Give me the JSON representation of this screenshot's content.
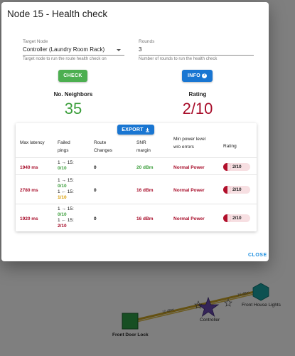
{
  "dialog": {
    "title": "Node 15 - Health check",
    "target_node": {
      "label": "Target Node",
      "value": "Controller (Laundry Room Rack)",
      "help": "Target node to run the route health check on"
    },
    "rounds": {
      "label": "Rounds",
      "value": "3",
      "help": "Number of rounds to run the health check"
    },
    "check_button": "CHECK",
    "info_button": "INFO",
    "neighbors": {
      "label": "No. Neighbors",
      "value": "35"
    },
    "rating": {
      "label": "Rating",
      "value": "2/10"
    },
    "export_button": "EXPORT",
    "table": {
      "headers": {
        "max_latency": "Max latency",
        "failed_pings": "Failed pings",
        "route_changes": "Route Changes",
        "snr_margin": "SNR margin",
        "min_power": "Min power level w/o errors",
        "rating": "Rating"
      },
      "rows": [
        {
          "latency": "1940 ms",
          "pings": [
            {
              "dir": "1 → 15:",
              "val": "0/10"
            }
          ],
          "route_changes": "0",
          "snr": "20 dBm",
          "power": "Normal Power",
          "rating": "2/10"
        },
        {
          "latency": "2780 ms",
          "pings": [
            {
              "dir": "1 → 15:",
              "val": "0/10"
            },
            {
              "dir": "1 ← 15:",
              "val": "1/10"
            }
          ],
          "route_changes": "0",
          "snr": "16 dBm",
          "power": "Normal Power",
          "rating": "2/10"
        },
        {
          "latency": "1920 ms",
          "pings": [
            {
              "dir": "1 → 15:",
              "val": "0/10"
            },
            {
              "dir": "1 ← 15:",
              "val": "2/10"
            }
          ],
          "route_changes": "0",
          "snr": "16 dBm",
          "power": "Normal Power",
          "rating": "2/10"
        }
      ]
    },
    "close_button": "CLOSE"
  },
  "map": {
    "nodes": {
      "front_door_lock": "Front Door Lock",
      "controller": "Controller",
      "front_house_lights": "Front House Lights"
    },
    "edge_labels": [
      "10 dBm",
      "10 dBm"
    ]
  },
  "colors": {
    "accent_green": "#4caf50",
    "accent_blue": "#1976d2",
    "rating_red": "#a80d2a",
    "neighbors_green": "#3b9e3b"
  }
}
